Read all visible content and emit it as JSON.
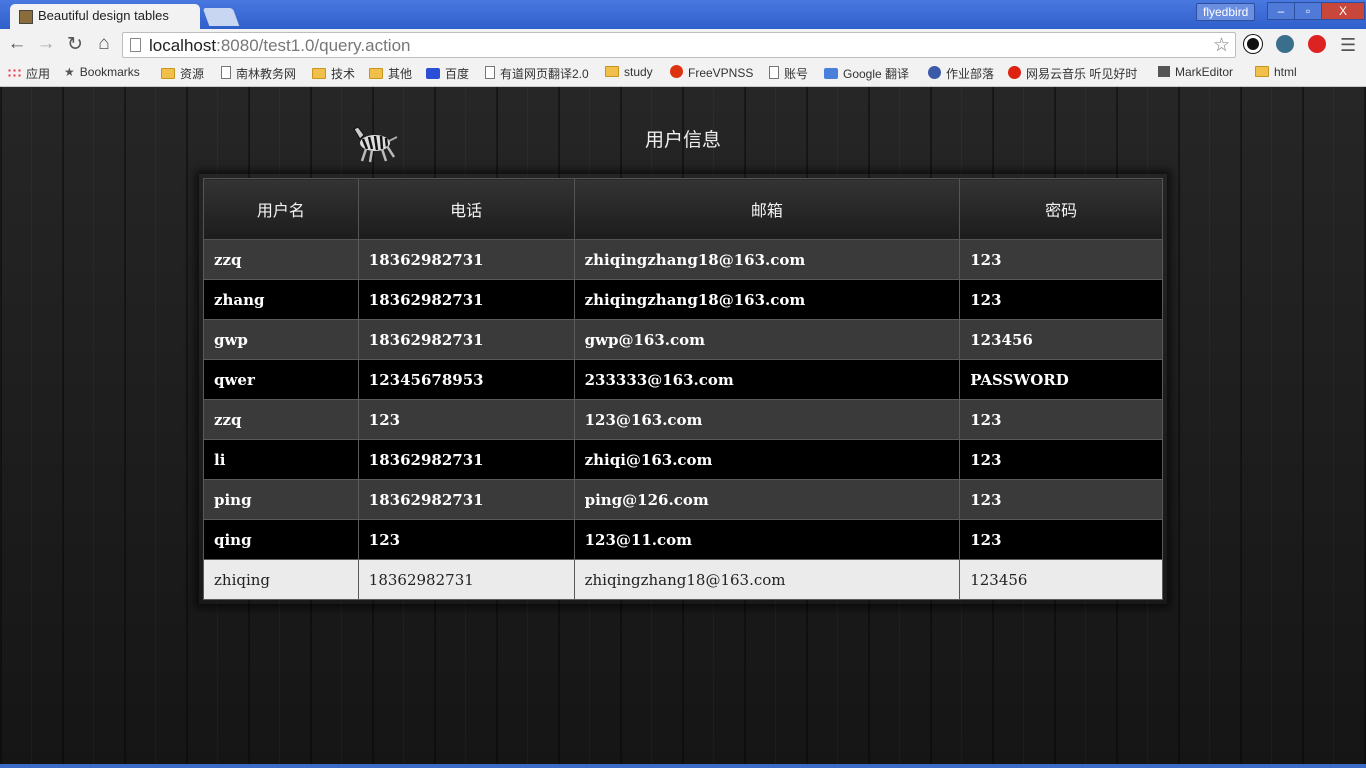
{
  "browser": {
    "tab_title": "Beautiful design tables",
    "user": "flyedbird",
    "url_host": "localhost",
    "url_rest": ":8080/test1.0/query.action",
    "window_buttons": {
      "minimize": "–",
      "maximize": "▫",
      "close": "X"
    }
  },
  "bookmarks": [
    {
      "label": "应用",
      "icon": "apps-grid-icon"
    },
    {
      "label": "Bookmarks",
      "icon": "star-icon"
    },
    {
      "label": "资源",
      "icon": "folder-icon"
    },
    {
      "label": "南林教务网",
      "icon": "page-icon"
    },
    {
      "label": "技术",
      "icon": "folder-icon"
    },
    {
      "label": "其他",
      "icon": "folder-icon"
    },
    {
      "label": "百度",
      "icon": "baidu-icon"
    },
    {
      "label": "有道网页翻译2.0",
      "icon": "page-icon"
    },
    {
      "label": "study",
      "icon": "folder-icon"
    },
    {
      "label": "FreeVPNSS",
      "icon": "p-logo-icon"
    },
    {
      "label": "账号",
      "icon": "page-icon"
    },
    {
      "label": "Google 翻译",
      "icon": "translate-icon"
    },
    {
      "label": "作业部落",
      "icon": "zybl-icon"
    },
    {
      "label": "网易云音乐 听见好时",
      "icon": "netease-icon"
    },
    {
      "label": "MarkEditor",
      "icon": "markeditor-icon"
    },
    {
      "label": "html",
      "icon": "folder-icon"
    }
  ],
  "page": {
    "title": "用户信息",
    "table": {
      "headers": [
        "用户名",
        "电话",
        "邮箱",
        "密码"
      ],
      "rows": [
        [
          "zzq",
          "18362982731",
          "zhiqingzhang18@163.com",
          "123"
        ],
        [
          "zhang",
          "18362982731",
          "zhiqingzhang18@163.com",
          "123"
        ],
        [
          "gwp",
          "18362982731",
          "gwp@163.com",
          "123456"
        ],
        [
          "qwer",
          "12345678953",
          "233333@163.com",
          "PASSWORD"
        ],
        [
          "zzq",
          "123",
          "123@163.com",
          "123"
        ],
        [
          "li",
          "18362982731",
          "zhiqi@163.com",
          "123"
        ],
        [
          "ping",
          "18362982731",
          "ping@126.com",
          "123"
        ],
        [
          "qing",
          "123",
          "123@11.com",
          "123"
        ],
        [
          "zhiqing",
          "18362982731",
          "zhiqingzhang18@163.com",
          "123456"
        ]
      ]
    }
  }
}
